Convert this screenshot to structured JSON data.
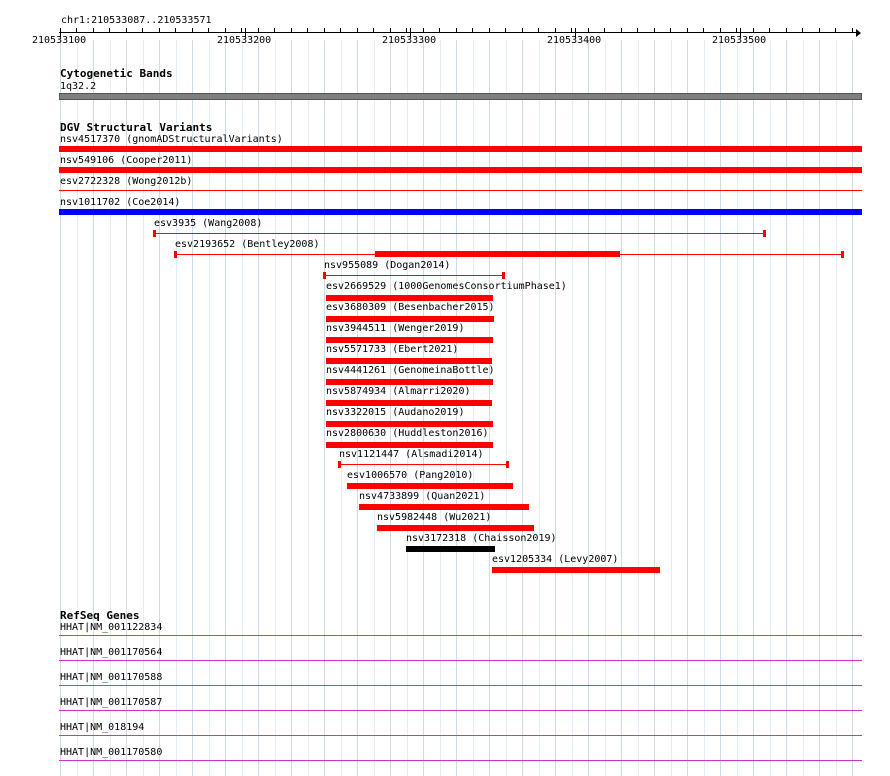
{
  "ruler": {
    "position": "chr1:210533087..210533571",
    "tick_labels": [
      "210533100",
      "210533200",
      "210533300",
      "210533400",
      "210533500"
    ]
  },
  "cytoband": {
    "title": "Cytogenetic Bands",
    "band": "1q32.2"
  },
  "dgv": {
    "title": "DGV Structural Variants",
    "variants": [
      {
        "id": "nsv4517370",
        "label": "nsv4517370 (gnomADStructuralVariants)",
        "color": "#ff0000",
        "style": "thick"
      },
      {
        "id": "nsv549106",
        "label": "nsv549106 (Cooper2011)",
        "color": "#ff0000",
        "style": "thick"
      },
      {
        "id": "esv2722328",
        "label": "esv2722328 (Wong2012b)",
        "color": "#ff0000",
        "style": "thin"
      },
      {
        "id": "nsv1011702",
        "label": "nsv1011702 (Coe2014)",
        "color": "#0000ff",
        "style": "thick"
      },
      {
        "id": "esv3935",
        "label": "esv3935 (Wang2008)",
        "color": "#ff0000",
        "style": "thin-capped"
      },
      {
        "id": "esv2193652",
        "label": "esv2193652 (Bentley2008)",
        "color": "#ff0000",
        "style": "thin-capped-with-block"
      },
      {
        "id": "nsv955089",
        "label": "nsv955089 (Dogan2014)",
        "color": "#ff0000",
        "style": "thin-capped"
      },
      {
        "id": "esv2669529",
        "label": "esv2669529 (1000GenomesConsortiumPhase1)",
        "color": "#ff0000",
        "style": "thick"
      },
      {
        "id": "esv3680309",
        "label": "esv3680309 (Besenbacher2015)",
        "color": "#ff0000",
        "style": "thick"
      },
      {
        "id": "nsv3944511",
        "label": "nsv3944511 (Wenger2019)",
        "color": "#ff0000",
        "style": "thick"
      },
      {
        "id": "nsv5571733",
        "label": "nsv5571733 (Ebert2021)",
        "color": "#ff0000",
        "style": "thick"
      },
      {
        "id": "nsv4441261",
        "label": "nsv4441261 (GenomeinaBottle)",
        "color": "#ff0000",
        "style": "thick"
      },
      {
        "id": "nsv5874934",
        "label": "nsv5874934 (Almarri2020)",
        "color": "#ff0000",
        "style": "thick"
      },
      {
        "id": "nsv3322015",
        "label": "nsv3322015 (Audano2019)",
        "color": "#ff0000",
        "style": "thick"
      },
      {
        "id": "nsv2800630",
        "label": "nsv2800630 (Huddleston2016)",
        "color": "#ff0000",
        "style": "thick"
      },
      {
        "id": "nsv1121447",
        "label": "nsv1121447 (Alsmadi2014)",
        "color": "#ff0000",
        "style": "thin-capped"
      },
      {
        "id": "esv1006570",
        "label": "esv1006570 (Pang2010)",
        "color": "#ff0000",
        "style": "thick"
      },
      {
        "id": "nsv4733899",
        "label": "nsv4733899 (Quan2021)",
        "color": "#ff0000",
        "style": "thick"
      },
      {
        "id": "nsv5982448",
        "label": "nsv5982448 (Wu2021)",
        "color": "#ff0000",
        "style": "thick"
      },
      {
        "id": "nsv3172318",
        "label": "nsv3172318 (Chaisson2019)",
        "color": "#000000",
        "style": "thick"
      },
      {
        "id": "esv1205334",
        "label": "esv1205334 (Levy2007)",
        "color": "#ff0000",
        "style": "thick"
      }
    ]
  },
  "refseq": {
    "title": "RefSeq Genes",
    "genes": [
      {
        "label": "HHAT|NM_001122834",
        "color": "#cc33cc"
      },
      {
        "label": "HHAT|NM_001170564",
        "color": "#cc33cc"
      },
      {
        "label": "HHAT|NM_001170588",
        "color": "#cc33cc"
      },
      {
        "label": "HHAT|NM_001170587",
        "color": "#cc33cc"
      },
      {
        "label": "HHAT|NM_018194",
        "color": "#cc33cc"
      },
      {
        "label": "HHAT|NM_001170580",
        "color": "#cc33cc"
      }
    ]
  }
}
